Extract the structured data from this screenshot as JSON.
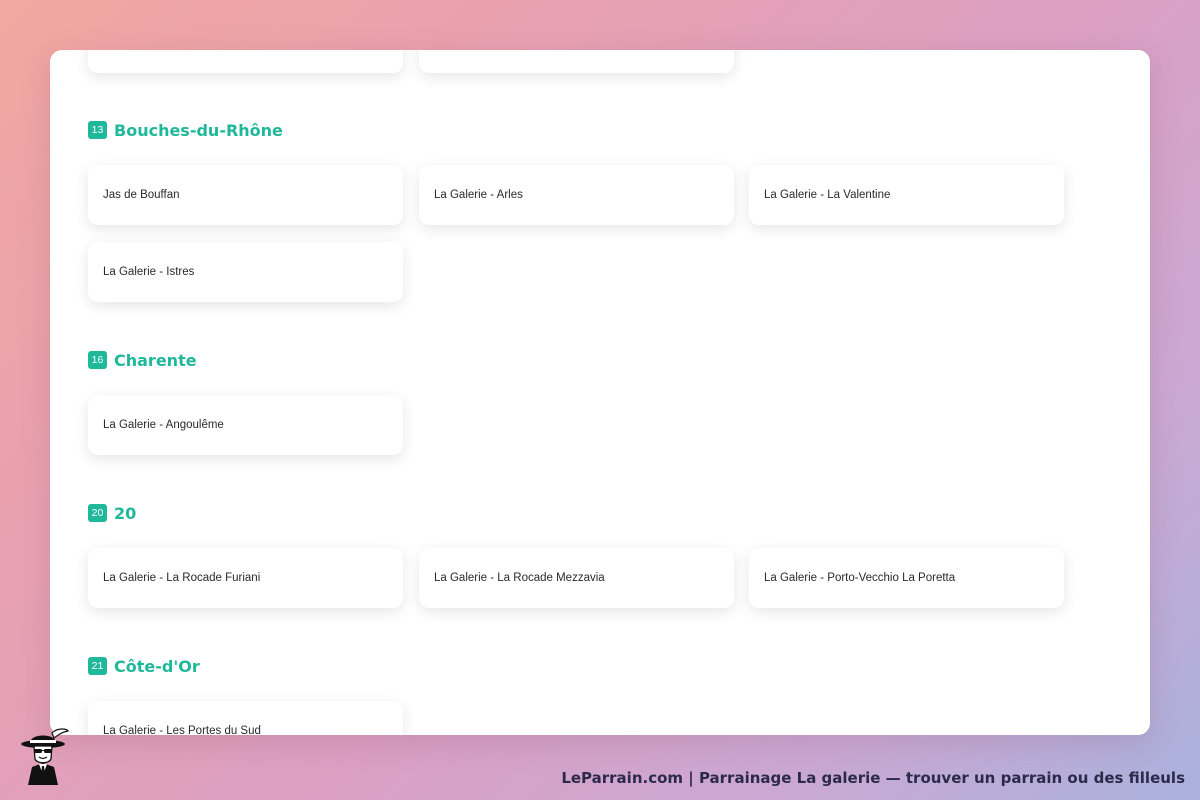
{
  "sections": [
    {
      "tiles": [
        "",
        ""
      ]
    },
    {
      "number": "13",
      "title": "Bouches-du-Rhône",
      "tiles": [
        "Jas de Bouffan",
        "La Galerie - Arles",
        "La Galerie - La Valentine",
        "La Galerie - Istres"
      ]
    },
    {
      "number": "16",
      "title": "Charente",
      "tiles": [
        "La Galerie - Angoulême"
      ]
    },
    {
      "number": "20",
      "title": "20",
      "tiles": [
        "La Galerie - La Rocade Furiani",
        "La Galerie - La Rocade Mezzavia",
        "La Galerie - Porto-Vecchio La Poretta"
      ]
    },
    {
      "number": "21",
      "title": "Côte-d'Or",
      "tiles": [
        "La Galerie - Les Portes du Sud"
      ]
    }
  ],
  "footer": {
    "caption": "LeParrain.com | Parrainage La galerie — trouver un parrain ou des filleuls"
  },
  "colors": {
    "accent": "#1fb89a",
    "text": "#2a2a2a",
    "footer_text": "#2c2a4a"
  },
  "icons": {
    "mascot": "mascot-icon"
  }
}
